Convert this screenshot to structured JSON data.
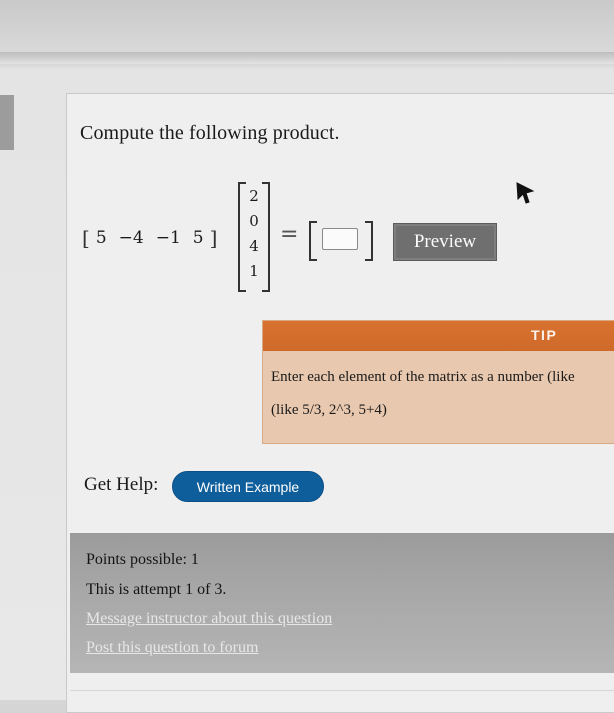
{
  "question": {
    "prompt": "Compute the following product.",
    "row_vector": [
      "5",
      "−4",
      "−1",
      "5"
    ],
    "column_vector": [
      "2",
      "0",
      "4",
      "1"
    ],
    "equals": "=",
    "answer_value": ""
  },
  "preview_button": {
    "label": "Preview"
  },
  "tip": {
    "title": "TIP",
    "line1": "Enter each element of the matrix as a number (like",
    "line2": "(like 5/3, 2^3, 5+4)"
  },
  "help": {
    "label": "Get Help:",
    "written_example": "Written Example"
  },
  "info": {
    "points": "Points possible: 1",
    "attempt": "This is attempt 1 of 3.",
    "message_link": "Message instructor about this question",
    "post_link": "Post this question to forum"
  },
  "colors": {
    "tip_header": "#d8722f",
    "tip_body": "#e8c8ae",
    "help_button": "#0f5e9c",
    "preview_button": "#6f6f6f",
    "info_box": "#a7a7a7"
  }
}
